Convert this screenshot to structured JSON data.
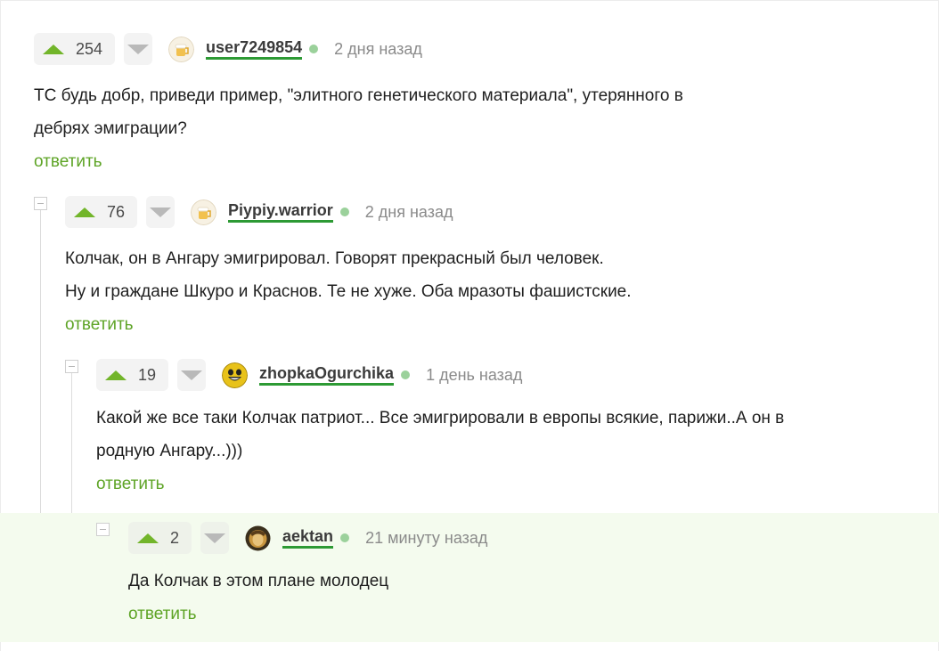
{
  "comments": [
    {
      "score": "254",
      "user": "user7249854",
      "time": "2 дня назад",
      "lines": [
        "ТС будь добр, приведи пример, \"элитного генетического материала\", утерянного в",
        "дебрях эмиграции?"
      ],
      "reply": "ответить",
      "avatar": "beer-mug-avatar"
    },
    {
      "score": "76",
      "user": "Piypiy.warrior",
      "time": "2 дня назад",
      "lines": [
        "Колчак, он в Ангару эмигрировал. Говорят прекрасный был человек.",
        "Ну и граждане Шкуро и Краснов. Те не хуже. Оба мразоты фашистские."
      ],
      "reply": "ответить",
      "avatar": "beer-mug-avatar"
    },
    {
      "score": "19",
      "user": "zhopkaOgurchika",
      "time": "1 день назад",
      "lines": [
        "Какой же все таки Колчак патриот... Все эмигрировали в европы всякие, парижи..А он в",
        "родную Ангару...)))"
      ],
      "reply": "ответить",
      "avatar": "smiley-avatar"
    },
    {
      "score": "2",
      "user": "aektan",
      "time": "21 минуту назад",
      "lines": [
        "Да Колчак в этом плане молодец"
      ],
      "reply": "ответить",
      "avatar": "photo-avatar"
    }
  ],
  "colors": {
    "upvote": "#72b52a",
    "reply": "#5ea426",
    "nick_underline": "#2d9a34",
    "online": "#9bd19b",
    "highlight": "#f4fbee"
  }
}
